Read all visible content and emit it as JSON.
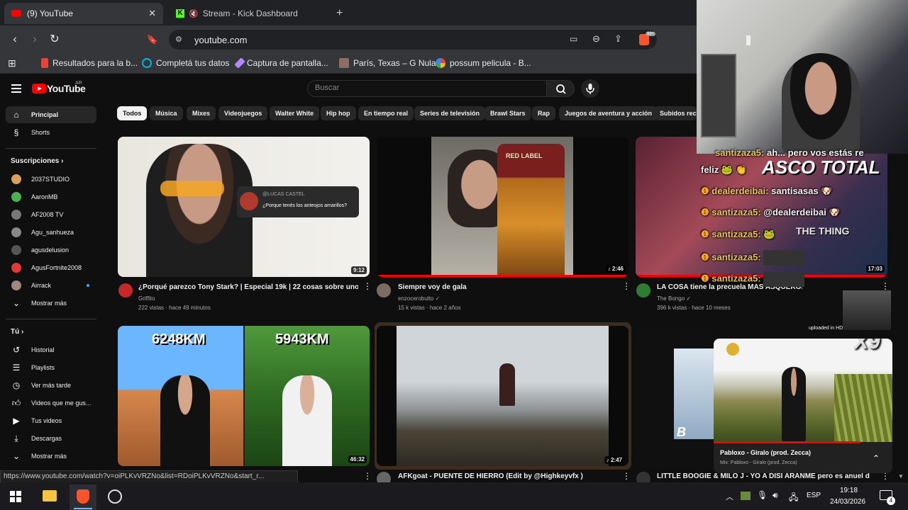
{
  "browser": {
    "tabs": [
      {
        "label": "(9) YouTube",
        "close": "✕"
      },
      {
        "label": "Stream - Kick Dashboard"
      }
    ],
    "new_tab": "+",
    "url": "youtube.com",
    "extension_badge": "99+",
    "bookmarks": [
      {
        "label": "Resultados para la b..."
      },
      {
        "label": "Completá tus datos"
      },
      {
        "label": "Captura de pantalla..."
      },
      {
        "label": "París, Texas – G Nula"
      },
      {
        "label": "possum pelicula - B..."
      }
    ]
  },
  "youtube": {
    "logo_text": "YouTube",
    "country": "AR",
    "search_placeholder": "Buscar",
    "chips": [
      "Todos",
      "Música",
      "Mixes",
      "Videojuegos",
      "Walter White",
      "Hip hop",
      "En tiempo real",
      "Series de televisión",
      "Brawl Stars",
      "Rap",
      "Juegos de aventura y acción",
      "Subidos reci"
    ],
    "sidebar": {
      "main": [
        {
          "label": "Principal",
          "icon": "home-icon"
        },
        {
          "label": "Shorts",
          "icon": "shorts-icon"
        }
      ],
      "subs_heading": "Suscripciones",
      "subscriptions": [
        {
          "label": "2037STUDIO",
          "color": "#d9a05b"
        },
        {
          "label": "AaronMB",
          "color": "#4caf50"
        },
        {
          "label": "AF2008 TV",
          "color": "#777777"
        },
        {
          "label": "Agu_sanhueza",
          "color": "#888888"
        },
        {
          "label": "agusdelusion",
          "color": "#555555"
        },
        {
          "label": "AgusFortnite2008",
          "color": "#e53935"
        },
        {
          "label": "Airrack",
          "color": "#a1887f"
        }
      ],
      "show_more_subs": "Mostrar más",
      "you_heading": "Tú",
      "you": [
        {
          "label": "Historial",
          "icon": "history-icon"
        },
        {
          "label": "Playlists",
          "icon": "playlist-icon"
        },
        {
          "label": "Ver más tarde",
          "icon": "clock-icon"
        },
        {
          "label": "Videos que me gus...",
          "icon": "thumbs-up-icon"
        },
        {
          "label": "Tus videos",
          "icon": "video-icon"
        },
        {
          "label": "Descargas",
          "icon": "download-icon"
        }
      ],
      "show_more_you": "Mostrar más"
    },
    "videos": [
      {
        "title": "¿Porqué parezco Tony Stark? | Especial 19k | 22 cosas sobre uno",
        "channel": "Griffito",
        "meta": "222 vistas · hace 49 minutos",
        "duration": "9:12",
        "comment_name": "@LUCAS CASTEL",
        "comment_text": "¿Porque tenés los anteojos amarillos?"
      },
      {
        "title": "Siempre voy de gala",
        "channel": "enzocerobulto",
        "meta": "15 k vistas · hace 2 años",
        "duration": "2:46",
        "label_text": "RED LABEL"
      },
      {
        "title": "LA COSA tiene la precuela MAS ASQUEROSA",
        "channel": "The Bongo",
        "meta": "396 k vistas · hace 10 meses",
        "duration": "17:03",
        "thumb_text": "ASCO TOTAL",
        "thumb_text2": "THE THING"
      },
      {
        "title": "",
        "channel": "",
        "meta": "",
        "duration": "46:32",
        "thumb_left": "6248KM",
        "thumb_right": "5943KM"
      },
      {
        "title": "AFKgoat - PUENTE DE HIERRO (Edit by @Highkeyvfx )",
        "channel": "",
        "meta": "",
        "duration": "2:47"
      },
      {
        "title": "LITTLE BOOGIE & MILO J - YO A DISI ARAÑME pero es anuel de",
        "channel": "",
        "meta": ""
      }
    ],
    "miniplayer": {
      "title": "Pabloxo - Giralo (prod. Zecca)",
      "subtitle": "Mix: Pabloxo - Giralo (prod. Zecca)",
      "progress": 0.82
    }
  },
  "status_url": "https://www.youtube.com/watch?v=oiPLKvVRZNo&list=RDoiPLKvVRZNo&start_r...",
  "stream_overlay": {
    "chat": [
      {
        "user": "santizaza5:",
        "msg": "ah... pero vos estás re",
        "user_color": "#e8c35a"
      },
      {
        "user": "",
        "msg": "feliz 🐸 👏",
        "user_color": "#ffffff"
      },
      {
        "user": "dealerdeibai:",
        "msg": "santisasas 🐶",
        "user_color": "#e8c35a"
      },
      {
        "user": "santizaza5:",
        "msg": "@dealerdeibai 🐶",
        "user_color": "#e8c35a"
      },
      {
        "user": "santizaza5:",
        "msg": "🐸",
        "user_color": "#e8c35a"
      },
      {
        "user": "santizaza5:",
        "msg": "",
        "user_color": "#e8c35a"
      },
      {
        "user": "santizaza5:",
        "msg": "",
        "user_color": "#e8c35a"
      }
    ],
    "multiplier": "X9",
    "uploaded": "uploaded in HD"
  },
  "taskbar": {
    "lang": "ESP",
    "time": "19:18",
    "date": "24/03/2026",
    "notif_count": "4"
  }
}
